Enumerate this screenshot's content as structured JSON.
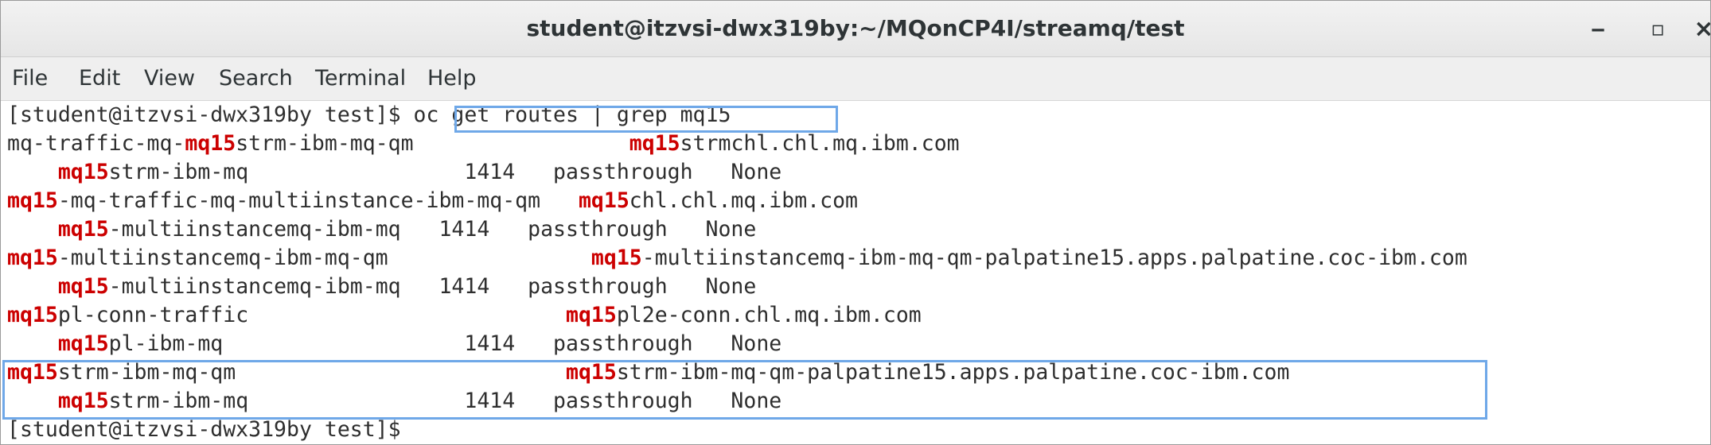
{
  "window": {
    "title": "student@itzvsi-dwx319by:~/MQonCP4I/streamq/test",
    "minimize_glyph": "‒",
    "maximize_glyph": "▫",
    "close_glyph": "×"
  },
  "menu": [
    "File",
    "Edit",
    "View",
    "Search",
    "Terminal",
    "Help"
  ],
  "highlight_term": "mq15",
  "terminal": {
    "prompt": "[student@itzvsi-dwx319by test]$",
    "command": " oc get routes | grep mq15",
    "lines": [
      {
        "pre": "mq-traffic-mq-",
        "hl": "mq15",
        "mid": "strm-ibm-mq-qm                 ",
        "hl2": "mq15",
        "post": "strmchl.chl.mq.ibm.com"
      },
      {
        "pre": "    ",
        "hl": "mq15",
        "mid": "strm-ibm-mq                 1414   passthrough   None",
        "hl2": "",
        "post": ""
      },
      {
        "pre": "",
        "hl": "mq15",
        "mid": "-mq-traffic-mq-multiinstance-ibm-mq-qm   ",
        "hl2": "mq15",
        "post": "chl.chl.mq.ibm.com"
      },
      {
        "pre": "    ",
        "hl": "mq15",
        "mid": "-multiinstancemq-ibm-mq   1414   passthrough   None",
        "hl2": "",
        "post": ""
      },
      {
        "pre": "",
        "hl": "mq15",
        "mid": "-multiinstancemq-ibm-mq-qm                ",
        "hl2": "mq15",
        "post": "-multiinstancemq-ibm-mq-qm-palpatine15.apps.palpatine.coc-ibm.com"
      },
      {
        "pre": "    ",
        "hl": "mq15",
        "mid": "-multiinstancemq-ibm-mq   1414   passthrough   None",
        "hl2": "",
        "post": ""
      },
      {
        "pre": "",
        "hl": "mq15",
        "mid": "pl-conn-traffic                         ",
        "hl2": "mq15",
        "post": "pl2e-conn.chl.mq.ibm.com"
      },
      {
        "pre": "    ",
        "hl": "mq15",
        "mid": "pl-ibm-mq                   1414   passthrough   None",
        "hl2": "",
        "post": ""
      },
      {
        "pre": "",
        "hl": "mq15",
        "mid": "strm-ibm-mq-qm                          ",
        "hl2": "mq15",
        "post": "strm-ibm-mq-qm-palpatine15.apps.palpatine.coc-ibm.com"
      },
      {
        "pre": "    ",
        "hl": "mq15",
        "mid": "strm-ibm-mq                 1414   passthrough   None",
        "hl2": "",
        "post": ""
      }
    ],
    "final_prompt": "[student@itzvsi-dwx319by test]$"
  },
  "colors": {
    "highlight": "#cc0000",
    "selection_box": "#6fa8e8",
    "text": "#2e2e2e"
  }
}
